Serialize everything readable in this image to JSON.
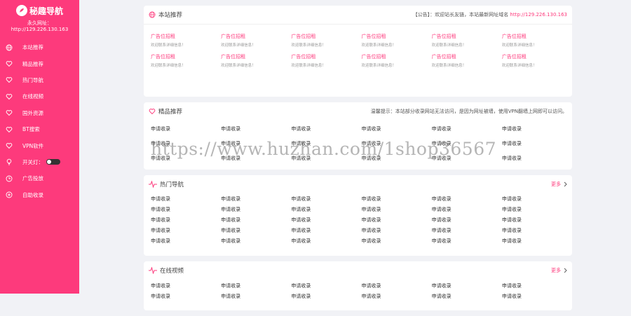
{
  "sidebar": {
    "logo_text": "秘趣导航",
    "permanent_url": "永久网址：http://129.226.130.163",
    "menu": [
      {
        "label": "本站推荐",
        "icon": "globe-icon"
      },
      {
        "label": "精品推荐",
        "icon": "heart-icon"
      },
      {
        "label": "热门导航",
        "icon": "heart-icon"
      },
      {
        "label": "在线视频",
        "icon": "heart-icon"
      },
      {
        "label": "国外资源",
        "icon": "heart-icon"
      },
      {
        "label": "BT搜索",
        "icon": "heart-icon"
      },
      {
        "label": "VPN软件",
        "icon": "heart-icon"
      },
      {
        "label": "开关灯：",
        "icon": "bulb-icon"
      },
      {
        "label": "广告投放",
        "icon": "clock-icon"
      },
      {
        "label": "自助收录",
        "icon": "plus-circle-icon"
      }
    ]
  },
  "sections": {
    "recommend": {
      "title": "本站推荐",
      "notice_prefix": "【公告】：欢迎站长友链，本站最新网址域名",
      "notice_url": "http://129.226.130.163",
      "ads": [
        {
          "title": "广告位招租",
          "sub": "欢迎联系详细信息！"
        },
        {
          "title": "广告位招租",
          "sub": "欢迎联系详细信息！"
        },
        {
          "title": "广告位招租",
          "sub": "欢迎联系详细信息！"
        },
        {
          "title": "广告位招租",
          "sub": "欢迎联系详细信息！"
        },
        {
          "title": "广告位招租",
          "sub": "欢迎联系详细信息！"
        },
        {
          "title": "广告位招租",
          "sub": "欢迎联系详细信息！"
        },
        {
          "title": "广告位招租",
          "sub": "欢迎联系详细信息！"
        },
        {
          "title": "广告位招租",
          "sub": "欢迎联系详细信息！"
        },
        {
          "title": "广告位招租",
          "sub": "欢迎联系详细信息！"
        },
        {
          "title": "广告位招租",
          "sub": "欢迎联系详细信息！"
        },
        {
          "title": "广告位招租",
          "sub": "欢迎联系详细信息！"
        },
        {
          "title": "广告位招租",
          "sub": "欢迎联系详细信息！"
        }
      ]
    },
    "featured": {
      "title": "精品推荐",
      "tip": "温馨提示：本站部分收录网站无法访问，是因为网址被墙，使用VPN翻墙上网即可以访问。",
      "links": [
        "申请收录",
        "申请收录",
        "申请收录",
        "申请收录",
        "申请收录",
        "申请收录",
        "申请收录",
        "申请收录",
        "申请收录",
        "申请收录",
        "申请收录",
        "申请收录",
        "申请收录",
        "申请收录",
        "申请收录",
        "申请收录",
        "申请收录",
        "申请收录"
      ]
    },
    "hot": {
      "title": "热门导航",
      "more": "更多",
      "links": [
        "申请收录",
        "申请收录",
        "申请收录",
        "申请收录",
        "申请收录",
        "申请收录",
        "申请收录",
        "申请收录",
        "申请收录",
        "申请收录",
        "申请收录",
        "申请收录",
        "申请收录",
        "申请收录",
        "申请收录",
        "申请收录",
        "申请收录",
        "申请收录",
        "申请收录",
        "申请收录",
        "申请收录",
        "申请收录",
        "申请收录",
        "申请收录",
        "申请收录",
        "申请收录",
        "申请收录",
        "申请收录",
        "申请收录",
        "申请收录"
      ]
    },
    "video": {
      "title": "在线视频",
      "more": "更多",
      "links": [
        "申请收录",
        "申请收录",
        "申请收录",
        "申请收录",
        "申请收录",
        "申请收录",
        "申请收录",
        "申请收录",
        "申请收录",
        "申请收录",
        "申请收录",
        "申请收录"
      ]
    }
  },
  "watermark": "https://www.huzhan.com/1shop36567",
  "colors": {
    "accent": "#fd3a7c",
    "background": "#f1f2f6"
  }
}
